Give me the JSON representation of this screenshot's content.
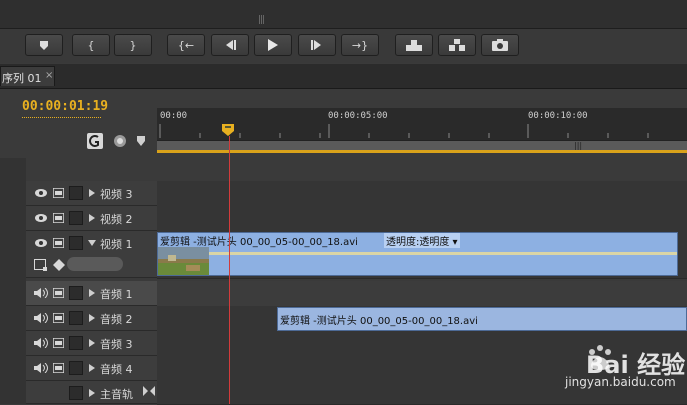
{
  "tab": {
    "label": "序列 01",
    "close": "×"
  },
  "header": {
    "timecode": "00:00:01:19"
  },
  "ruler": {
    "ticks": [
      "00:00",
      "00:00:05:00",
      "00:00:10:00"
    ]
  },
  "tracks": [
    {
      "name": "视频 3"
    },
    {
      "name": "视频 2"
    },
    {
      "name": "视频 1"
    },
    {
      "name": "音频 1"
    },
    {
      "name": "音频 2"
    },
    {
      "name": "音频 3"
    },
    {
      "name": "音频 4"
    },
    {
      "name": "主音轨"
    }
  ],
  "clips": {
    "video": {
      "title": "爱剪辑 -测试片头  00_00_05-00_00_18.avi",
      "effect": "透明度:透明度 ▾"
    },
    "audio": {
      "title": "爱剪辑 -测试片头  00_00_05-00_00_18.avi"
    }
  },
  "transport": {
    "mark_in": "{",
    "mark_out": "}",
    "go_in": "{←",
    "go_out": "→}"
  },
  "watermark": {
    "brand": "Bai 经验",
    "url": "jingyan.baidu.com"
  },
  "colors": {
    "timecode": "#e8b020",
    "playhead": "#d23b3b",
    "clip": "#8db0e2",
    "workarea": "#d9a21a"
  }
}
